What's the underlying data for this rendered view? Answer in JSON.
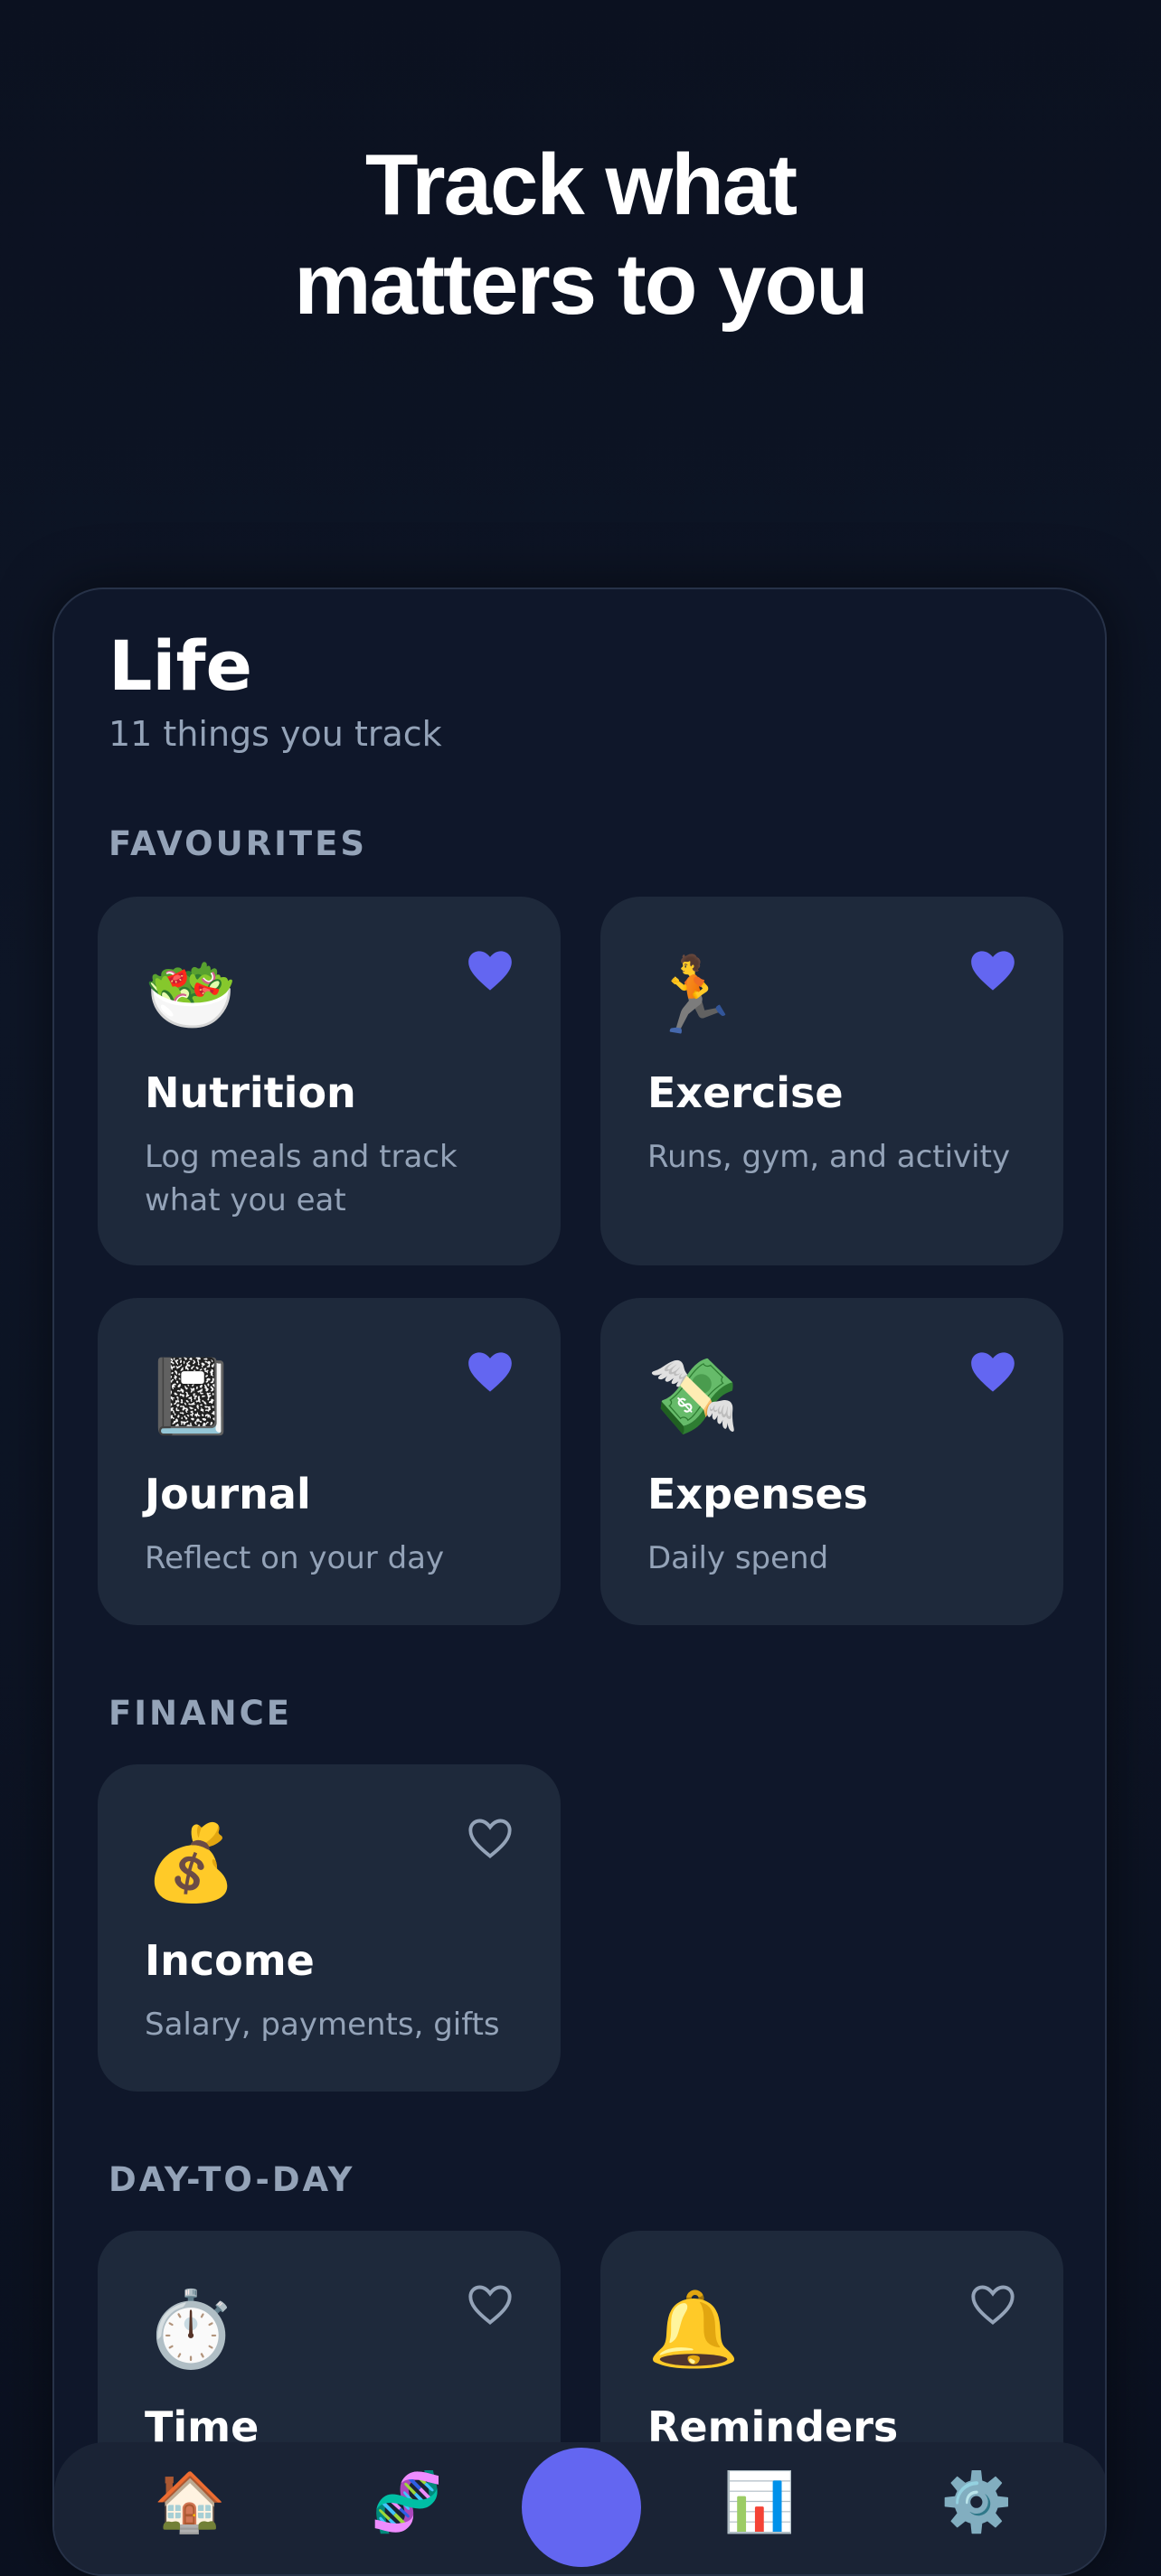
{
  "hero": {
    "line1": "Track what",
    "line2": "matters to you"
  },
  "page": {
    "title": "Life",
    "subtitle": "11 things you track"
  },
  "sections": {
    "favourites": "FAVOURITES",
    "finance": "FINANCE",
    "day_to_day": "DAY-TO-DAY"
  },
  "cards": {
    "nutrition": {
      "emoji": "🥗",
      "name": "Nutrition",
      "desc": "Log meals and track what you eat",
      "favourite": true
    },
    "exercise": {
      "emoji": "🏃",
      "name": "Exercise",
      "desc": "Runs, gym, and activity",
      "favourite": true
    },
    "journal": {
      "emoji": "📓",
      "name": "Journal",
      "desc": "Reflect on your day",
      "favourite": true
    },
    "expenses": {
      "emoji": "💸",
      "name": "Expenses",
      "desc": "Daily spend",
      "favourite": true
    },
    "income": {
      "emoji": "💰",
      "name": "Income",
      "desc": "Salary, payments, gifts",
      "favourite": false
    },
    "time": {
      "emoji": "⏱️",
      "name": "Time",
      "desc": "",
      "favourite": false
    },
    "reminders": {
      "emoji": "🔔",
      "name": "Reminders",
      "desc": "",
      "favourite": false
    }
  },
  "tabbar": {
    "home_icon": "🏠",
    "explore_icon": "🧬",
    "stats_icon": "📊",
    "settings_icon": "⚙️"
  },
  "colors": {
    "accent": "#6366f1",
    "card_bg": "#1e293b",
    "muted_text": "#94a3b8"
  }
}
